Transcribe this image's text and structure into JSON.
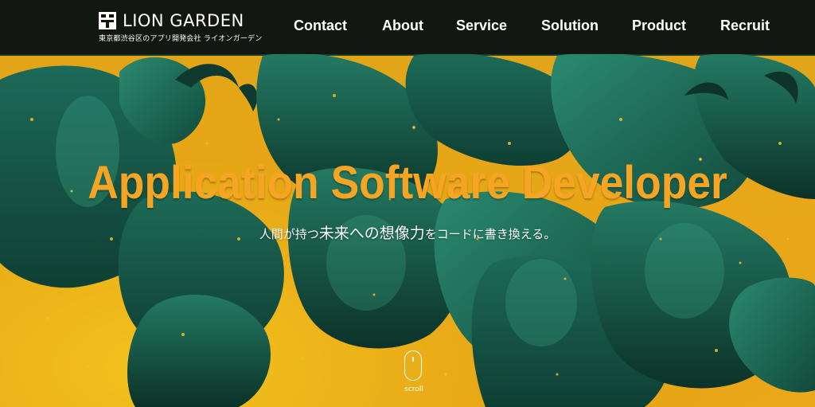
{
  "header": {
    "logo_text": "LION GARDEN",
    "logo_subtitle": "東京都渋谷区のアプリ開発会社 ライオンガーデン",
    "nav": [
      {
        "label": "Contact"
      },
      {
        "label": "About"
      },
      {
        "label": "Service"
      },
      {
        "label": "Solution"
      },
      {
        "label": "Product"
      },
      {
        "label": "Recruit"
      }
    ]
  },
  "hero": {
    "headline": "Application Software Developer",
    "tagline_part1": "人間が持つ",
    "tagline_part2": "未来への想像力",
    "tagline_part3": "をコードに書き換える。",
    "scroll_label": "scroll"
  },
  "colors": {
    "header_bg": "#12120e",
    "headline": "#f5a523",
    "hero_yellow": "#e9ac1c",
    "hero_teal": "#1f7a64"
  }
}
